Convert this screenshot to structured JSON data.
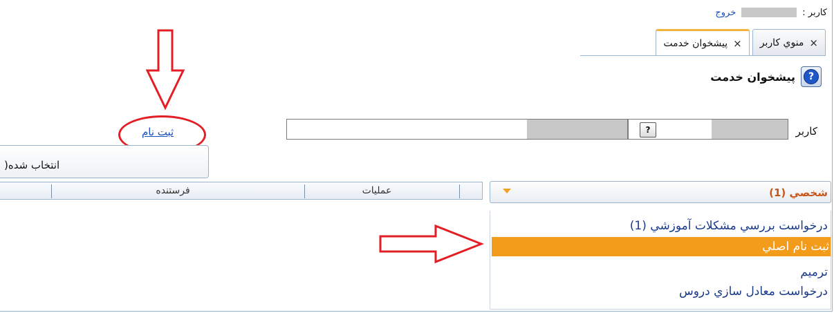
{
  "header": {
    "user_label": "کاربر :",
    "logout": "خروج"
  },
  "tabs": [
    {
      "label": "منوي کاربر",
      "close": "×"
    },
    {
      "label": "پیشخوان خدمت",
      "close": "×"
    }
  ],
  "page": {
    "title": "پیشخوان خدمت",
    "help_symbol": "?"
  },
  "search": {
    "user_label": "کاربر",
    "lookup_symbol": "?"
  },
  "actions": {
    "register_link": "ثبت نام"
  },
  "selected_panel": {
    "label": "انتخاب شده("
  },
  "grid": {
    "columns": [
      "فرستنده",
      "عملیات"
    ]
  },
  "category": {
    "title": "شخصي (1)",
    "items": [
      "درخواست بررسي مشکلات آموزشي (1)",
      "ثبت نام اصلي",
      "ترميم",
      "درخواست معادل سازي دروس"
    ]
  },
  "colors": {
    "annotation": "#e31e24",
    "highlight": "#f39b1a",
    "link": "#1a4dbe",
    "tab_accent": "#f3b33d"
  }
}
